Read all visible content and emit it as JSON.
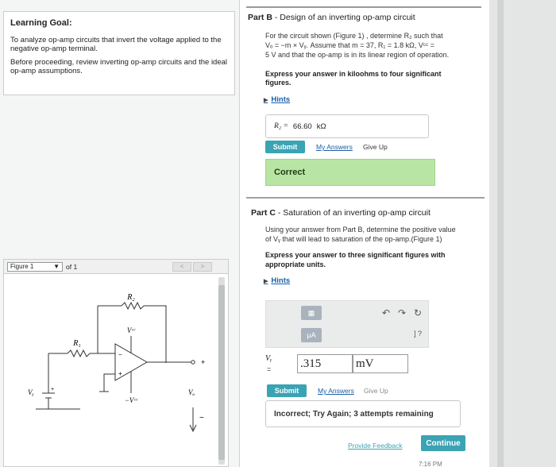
{
  "learning_goal": {
    "title": "Learning Goal:",
    "paragraph1": "To analyze op-amp circuits that invert the voltage applied to the negative op-amp terminal.",
    "paragraph2": "Before proceeding, review inverting op-amp circuits and the ideal op-amp assumptions."
  },
  "figure": {
    "label": "Figure 1",
    "of": "of 1",
    "nav_prev": "<",
    "nav_next": ">",
    "labels": {
      "r2": "R₂",
      "r1": "R₁",
      "vcc_pos": "Vᶜᶜ",
      "vcc_neg": "−Vᶜᶜ",
      "vz": "Vᵧ",
      "vo": "Vₒ",
      "plus": "+",
      "minus": "−"
    }
  },
  "part_b": {
    "title_bold": "Part B",
    "title_rest": " - Design of an inverting op-amp circuit",
    "line1": "For the circuit shown (Figure 1) , determine R₂ such that",
    "line2": "Vₒ = −m × Vᵧ. Assume that m = 37, R₁ = 1.8 kΩ, Vᶜᶜ =",
    "line3": "5 V and that the op-amp is in its linear region of operation.",
    "express1": "Express your answer in kiloohms to four significant",
    "express2": "figures.",
    "hints": "Hints",
    "answer_label": "R₂ =",
    "answer_value": "66.60",
    "answer_unit": "kΩ",
    "submit": "Submit",
    "my_answers": "My Answers",
    "give_up": "Give Up",
    "result": "Correct"
  },
  "part_c": {
    "title_bold": "Part C",
    "title_rest": " - Saturation of an inverting op-amp circuit",
    "line1": "Using your answer from Part B, determine the positive value",
    "line2": "of Vᵧ that will lead to saturation of the op-amp.(Figure 1)",
    "express1": "Express your answer to three significant figures with",
    "express2": "appropriate units.",
    "hints": "Hints",
    "toolbar": {
      "mu": "μA",
      "bracket": "] ?"
    },
    "answer_label": "Vᵧ",
    "answer_eq": "=",
    "answer_value": ".315",
    "answer_unit": "mV",
    "submit": "Submit",
    "my_answers": "My Answers",
    "give_up": "Give Up",
    "result": "Incorrect; Try Again; 3 attempts remaining"
  },
  "footer": {
    "provide_feedback": "Provide Feedback",
    "continue": "Continue",
    "time": "7:16 PM"
  },
  "colors": {
    "accent": "#3aa3b4",
    "correct_bg": "#b8e5a4",
    "link": "#1b5fa8"
  }
}
